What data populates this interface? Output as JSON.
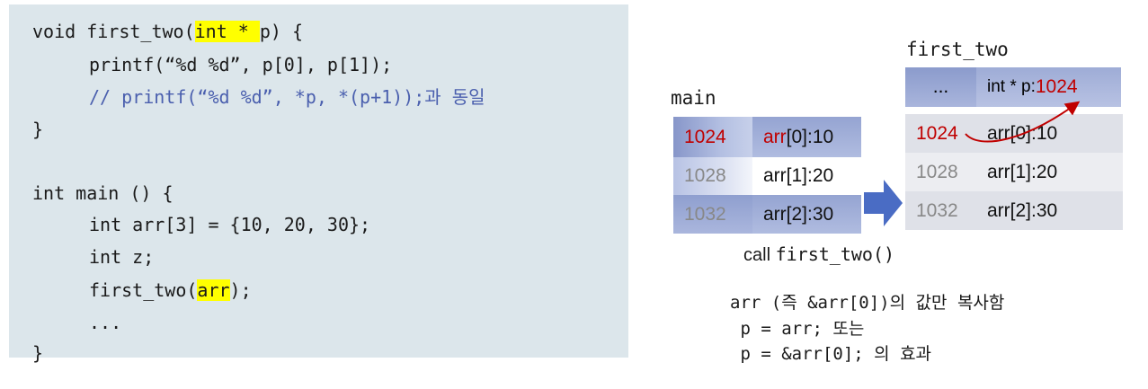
{
  "code": {
    "l1_pre": "void first_two(",
    "l1_hl": "int * ",
    "l1_post": "p) {",
    "l2": "printf(“%d %d”, p[0], p[1]);",
    "l3": "// printf(“%d %d”, *p, *(p+1));과 동일",
    "l4": "}",
    "l5": "int main () {",
    "l6": "int arr[3] = {10, 20, 30};",
    "l7": "int z;",
    "l8_pre": "first_two(",
    "l8_hl": "arr",
    "l8_post": ");",
    "l9": "...",
    "l10": "}"
  },
  "main_frame": {
    "title": "main",
    "rows": [
      {
        "addr": "1024",
        "value_name": "arr",
        "value_rest": "[0]:10"
      },
      {
        "addr": "1028",
        "value_name": "arr",
        "value_rest": "[1]:20"
      },
      {
        "addr": "1032",
        "value_name": "arr",
        "value_rest": "[2]:30"
      }
    ]
  },
  "first_two_frame": {
    "title": "first_two",
    "header": {
      "left": "...",
      "right_label": "int * p: ",
      "right_value": "1024"
    },
    "rows": [
      {
        "addr": "1024",
        "value": "arr[0]:10"
      },
      {
        "addr": "1028",
        "value": "arr[1]:20"
      },
      {
        "addr": "1032",
        "value": "arr[2]:30"
      }
    ]
  },
  "call_label": {
    "prefix": "call ",
    "func": "first_two()"
  },
  "notes": {
    "n1": "arr (즉 &arr[0])의 값만 복사함",
    "n2": " p = arr; 또는",
    "n3": " p = &arr[0]; 의 효과"
  },
  "colors": {
    "highlight": "#ffff00",
    "accent_red": "#c00000",
    "arrow_blue": "#4a6cc4",
    "comment_blue": "#4a5fae"
  }
}
